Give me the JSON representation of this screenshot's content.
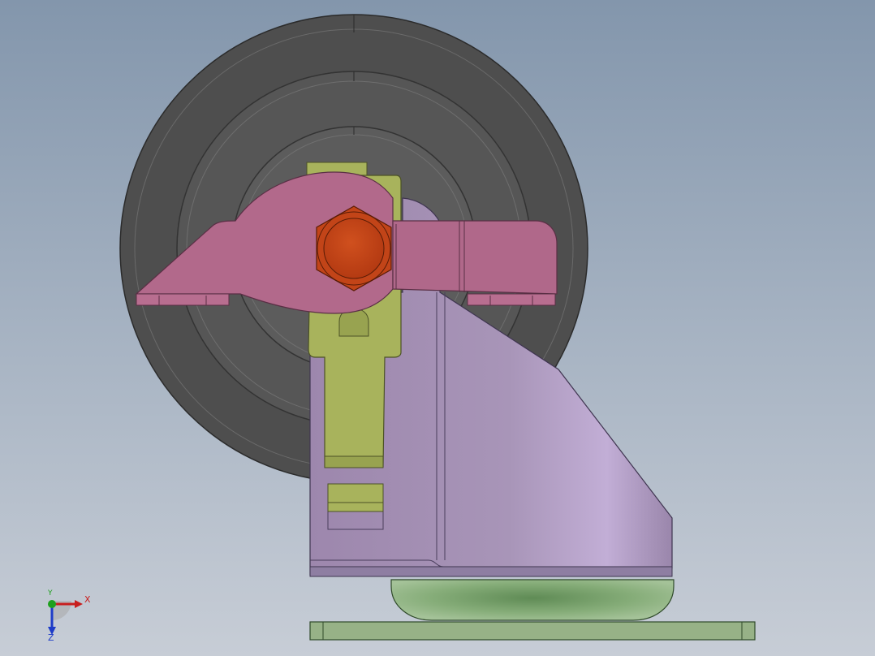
{
  "triad": {
    "x_label": "X",
    "y_label": "Y",
    "z_label": "Z",
    "x_color": "#c81e1e",
    "y_color": "#1ea01e",
    "z_color": "#1e3cc8"
  },
  "colors": {
    "background_top": "#8396ac",
    "background_bottom": "#c7cdd6",
    "wheel": "#4e4e4e",
    "brake_pedal": "#b2698b",
    "lock_lever": "#a8b35c",
    "swivel_bracket": "#a392b8",
    "axle_nut": "#c8481c",
    "rubber_pad": "#8fb183",
    "base_plate": "#97b287"
  }
}
